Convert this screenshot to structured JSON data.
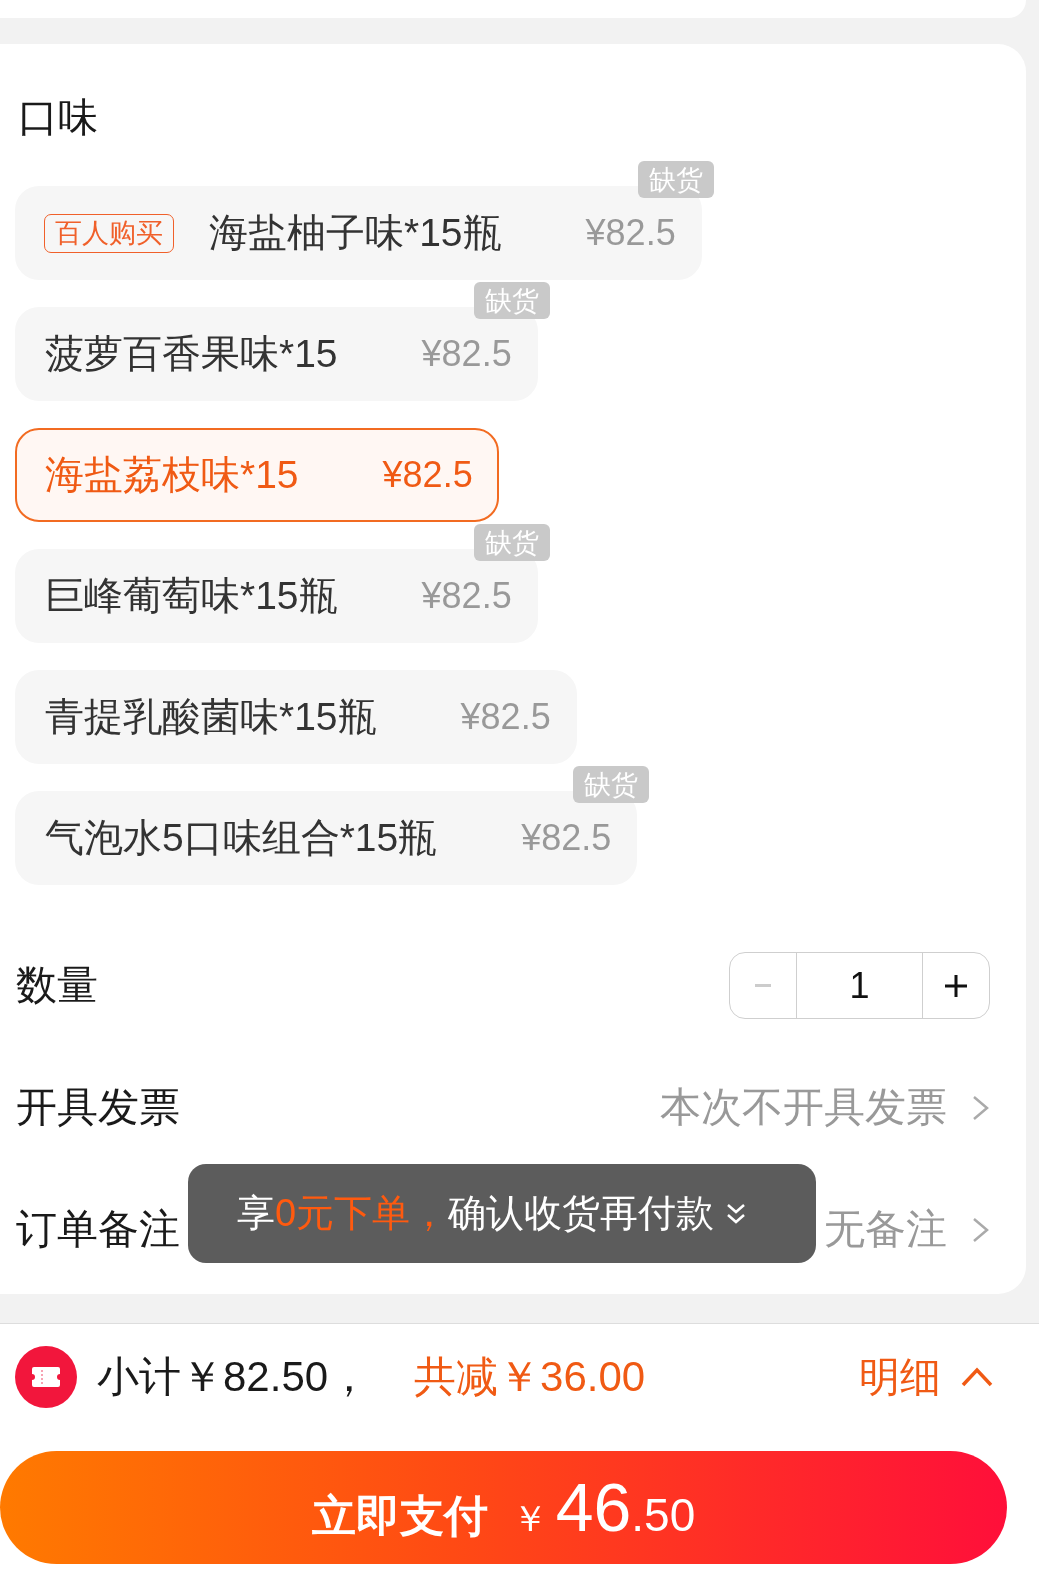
{
  "flavor": {
    "title": "口味",
    "options": [
      {
        "badge": "百人购买",
        "name": "海盐柚子味*15瓶",
        "price": "¥82.5",
        "stock_tag": "缺货",
        "selected": false
      },
      {
        "name": "菠萝百香果味*15",
        "price": "¥82.5",
        "stock_tag": "缺货",
        "selected": false
      },
      {
        "name": "海盐荔枝味*15",
        "price": "¥82.5",
        "selected": true
      },
      {
        "name": "巨峰葡萄味*15瓶",
        "price": "¥82.5",
        "stock_tag": "缺货",
        "selected": false
      },
      {
        "name": "青提乳酸菌味*15瓶",
        "price": "¥82.5",
        "selected": false
      },
      {
        "name": "气泡水5口味组合*15瓶",
        "price": "¥82.5",
        "stock_tag": "缺货",
        "selected": false
      }
    ]
  },
  "quantity": {
    "label": "数量",
    "value": "1",
    "decrease_disabled": true,
    "increase_disabled": false
  },
  "rows": [
    {
      "label": "开具发票",
      "value": "本次不开具发票"
    },
    {
      "label": "订单备注",
      "value": "无备注"
    }
  ],
  "tooltip": {
    "parts": [
      {
        "text": "享",
        "highlight": false
      },
      {
        "text": "0元下单，",
        "highlight": true
      },
      {
        "text": "确认收货再付款",
        "highlight": false
      }
    ]
  },
  "summary": {
    "subtotal": "小计￥82.50，",
    "discount": "共减￥36.00",
    "detail": "明细"
  },
  "pay_button": {
    "label": "立即支付",
    "currency": "￥",
    "amount_integer": "46",
    "amount_decimal": ".50"
  }
}
